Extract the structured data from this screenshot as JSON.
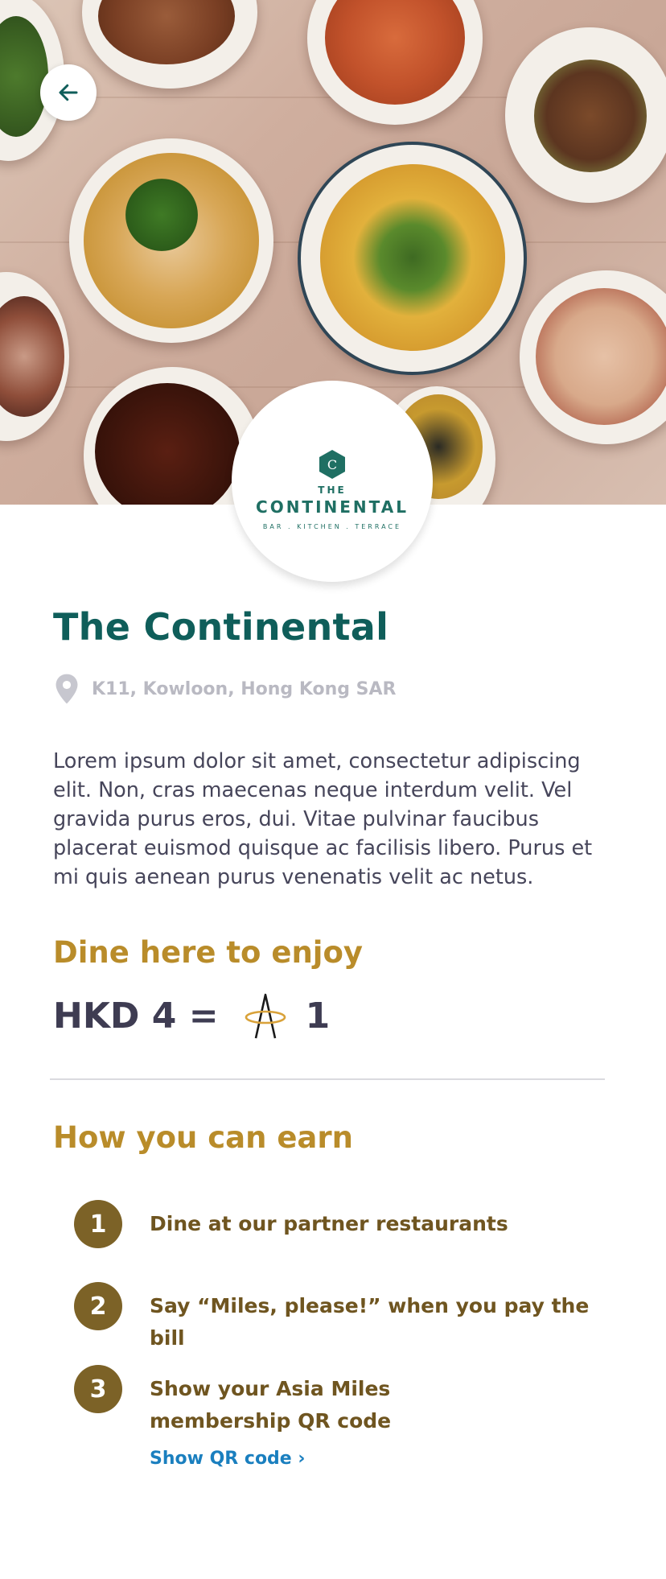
{
  "header": {
    "back_icon": "arrow-left-icon"
  },
  "restaurant": {
    "logo": {
      "the": "THE",
      "name": "CONTINENTAL",
      "tagline": "BAR . KITCHEN . TERRACE"
    },
    "name": "The Continental",
    "location_icon": "map-pin-icon",
    "location": "K11, Kowloon, Hong Kong SAR",
    "description": "Lorem ipsum dolor sit amet, consectetur adipiscing elit. Non, cras maecenas neque interdum velit. Vel gravida purus eros, dui. Vitae pulvinar faucibus placerat euismod quisque ac facilisis libero. Purus et mi quis aenean purus venenatis velit ac netus."
  },
  "dine": {
    "title": "Dine here to enjoy",
    "rate_left": "HKD 4 =",
    "rate_icon": "asia-miles-logo-icon",
    "rate_right": "1"
  },
  "earn": {
    "title": "How you can earn",
    "steps": [
      {
        "number": "1",
        "label": "Dine at our partner restaurants"
      },
      {
        "number": "2",
        "label": "Say “Miles, please!” when you pay the bill"
      },
      {
        "number": "3",
        "label": "Show your Asia Miles membership QR code"
      }
    ],
    "qr_link": "Show QR code ›"
  },
  "colors": {
    "brand_teal": "#0f5e5a",
    "gold": "#b98c2a",
    "step_circle": "#7c6227",
    "link": "#1a7fbf"
  }
}
